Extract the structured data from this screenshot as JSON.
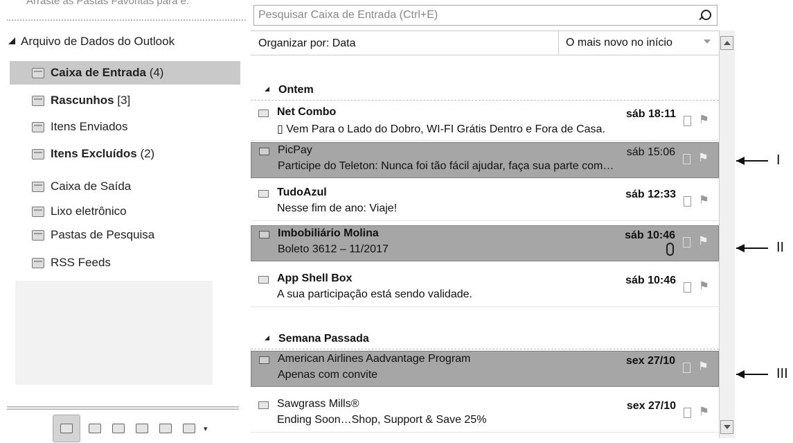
{
  "nav": {
    "favorites_hint": "Arraste as Pastas Favoritas para e:",
    "root_label": "Arquivo de Dados do Outlook",
    "folders": [
      {
        "name": "Caixa  de Entrada",
        "count": "(4)"
      },
      {
        "name": "Rascunhos",
        "count": "[3]"
      },
      {
        "name": "Itens Enviados",
        "count": ""
      },
      {
        "name": "Itens Excluídos",
        "count": "(2)"
      },
      {
        "name": "Caixa de Saída",
        "count": ""
      },
      {
        "name": "Lixo eletrônico",
        "count": ""
      },
      {
        "name": "Pastas de Pesquisa",
        "count": ""
      },
      {
        "name": "RSS Feeds",
        "count": ""
      }
    ],
    "modules": [
      "mail-icon",
      "calendar-icon",
      "contacts-icon",
      "tasks-icon",
      "notes-icon",
      "folder-icon"
    ],
    "module_more": "▾"
  },
  "list": {
    "search_placeholder": "Pesquisar Caixa de Entrada (Ctrl+E)",
    "arrange_by": "Organizar por: Data",
    "order": "O mais novo no início",
    "groups": [
      {
        "title": "Ontem",
        "messages": [
          {
            "sender": "Net Combo",
            "time": "sáb 18:11",
            "subject": "▯ Vem Para o Lado do Dobro, WI-FI Grátis Dentro e Fora de Casa."
          },
          {
            "sender": "PicPay",
            "time": "sáb 15:06",
            "subject": "Participe do Teleton: Nunca foi tão fácil ajudar, faça sua parte com…"
          },
          {
            "sender": "TudoAzul",
            "time": "sáb 12:33",
            "subject": "Nesse fim de ano: Viaje!"
          },
          {
            "sender": "Imbobiliário Molina",
            "time": "sáb 10:46",
            "subject": "Boleto 3612 – 11/2017"
          },
          {
            "sender": "App Shell Box",
            "time": "sáb 10:46",
            "subject": "A sua participação está sendo validade."
          }
        ]
      },
      {
        "title": "Semana Passada",
        "messages": [
          {
            "sender": "American Airlines Aadvantage Program",
            "time": "sex 27/10",
            "subject": "Apenas com convite"
          },
          {
            "sender": "Sawgrass Mills®",
            "time": "sex 27/10",
            "subject": "Ending Soon…Shop, Support & Save 25%"
          }
        ]
      }
    ]
  },
  "annotations": {
    "first": "I",
    "second": "II",
    "third": "III"
  },
  "colors": {
    "highlight": "#a6a6a6",
    "selected_folder": "#c9c9c9"
  }
}
